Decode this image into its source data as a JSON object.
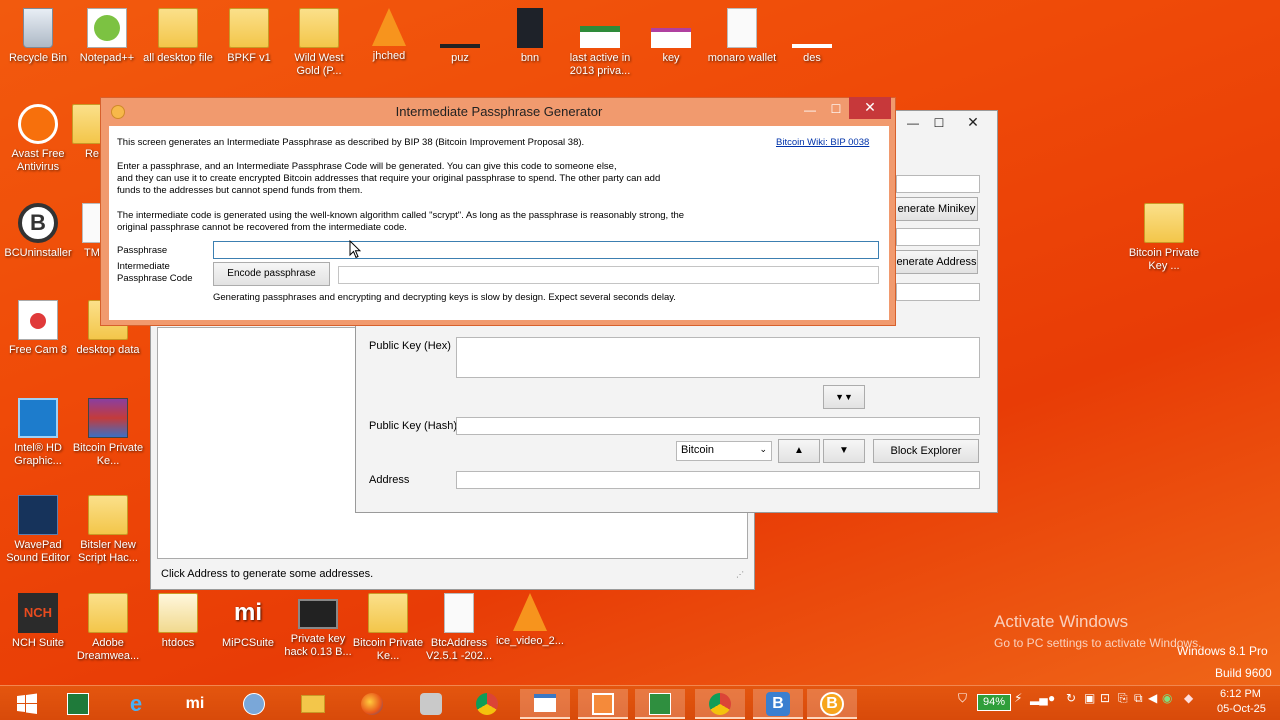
{
  "desktop": {
    "icons": [
      {
        "label": "Recycle Bin"
      },
      {
        "label": "Notepad++"
      },
      {
        "label": "all desktop file"
      },
      {
        "label": "BPKF v1"
      },
      {
        "label": "Wild West Gold (P..."
      },
      {
        "label": "jhched"
      },
      {
        "label": "puz"
      },
      {
        "label": "bnn"
      },
      {
        "label": "last active in 2013 priva..."
      },
      {
        "label": "key"
      },
      {
        "label": "monaro wallet"
      },
      {
        "label": "des"
      },
      {
        "label": "Avast Free Antivirus"
      },
      {
        "label": "Re"
      },
      {
        "label": "BCUninstaller"
      },
      {
        "label": "TM"
      },
      {
        "label": "Free Cam 8"
      },
      {
        "label": "desktop data"
      },
      {
        "label": "Intel® HD Graphic..."
      },
      {
        "label": "Bitcoin Private Ke..."
      },
      {
        "label": "WavePad Sound Editor"
      },
      {
        "label": "Bitsler New Script Hac..."
      },
      {
        "label": "NCH Suite"
      },
      {
        "label": "Adobe Dreamwea..."
      },
      {
        "label": "htdocs"
      },
      {
        "label": "MiPCSuite"
      },
      {
        "label": "Private key hack 0.13 B..."
      },
      {
        "label": "Bitcoin Private Ke..."
      },
      {
        "label": "BtcAddress V2.5.1 -202..."
      },
      {
        "label": "ice_video_2..."
      },
      {
        "label": "Bitcoin Private Key ..."
      }
    ]
  },
  "back_window": {
    "buttons": {
      "generate_minikey": "enerate Minikey",
      "generate_address": "enerate Address",
      "double_down": "▼▼",
      "up": "▲",
      "down": "▼",
      "block_explorer": "Block Explorer"
    },
    "labels": {
      "public_key_hex": "Public Key (Hex)",
      "public_key_hash": "Public Key (Hash)",
      "address": "Address"
    },
    "coin_select": "Bitcoin",
    "status_text": "Click Address to generate some addresses."
  },
  "dialog": {
    "title": "Intermediate Passphrase Generator",
    "wiki_link": "Bitcoin Wiki: BIP 0038",
    "para1": "This screen generates an Intermediate Passphrase as described by BIP 38 (Bitcoin Improvement Proposal 38).",
    "para2_l1": "Enter a passphrase, and an Intermediate Passphrase Code will be generated.  You can give this code to someone else,",
    "para2_l2": "and they can use it to create encrypted Bitcoin addresses that require your original passphrase to spend.  The other party can add",
    "para2_l3": "funds to the addresses but cannot spend funds from them.",
    "para3_l1": "The intermediate code is generated using the well-known algorithm called \"scrypt\".  As long as the passphrase is reasonably strong, the",
    "para3_l2": "original passphrase cannot be recovered from the intermediate code.",
    "passphrase_label": "Passphrase",
    "passphrase_value": "",
    "intermediate_label_l1": "Intermediate",
    "intermediate_label_l2": "Passphrase Code",
    "intermediate_value": "",
    "encode_button": "Encode passphrase",
    "note": "Generating passphrases and encrypting and decrypting keys is slow by design.  Expect several seconds delay."
  },
  "watermark": {
    "line1": "Activate Windows",
    "line2": "Go to PC settings to activate Windows.",
    "edition": "Windows 8.1 Pro",
    "build": "Build 9600"
  },
  "taskbar": {
    "battery": "94%",
    "time": "6:12 PM",
    "date": "05-Oct-25"
  }
}
